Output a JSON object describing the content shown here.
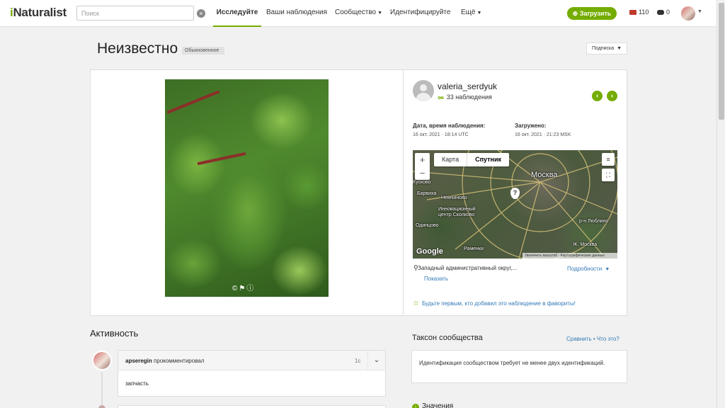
{
  "header": {
    "logo": "iNaturalist",
    "search_placeholder": "Поиск",
    "nav": [
      "Исследуйте",
      "Ваши наблюдения",
      "Сообщество",
      "Идентифицируйте",
      "Ещё"
    ],
    "upload_label": "Загрузить",
    "messages_count": "110",
    "notifications_count": "0"
  },
  "observation": {
    "title": "Неизвестно",
    "badge": "Обыкновенное",
    "subscribe_label": "Подписка"
  },
  "observer": {
    "username": "valeria_serdyuk",
    "observations": "33 наблюдения",
    "date_label": "Дата, время наблюдения:",
    "date_value": "16 окт. 2021 · 18:14 UTC",
    "uploaded_label": "Загружено:",
    "uploaded_value": "16 окт. 2021 · 21:23 MSK"
  },
  "map": {
    "type_map": "Карта",
    "type_satellite": "Спутник",
    "city": "Москва",
    "labels": [
      "Кусково",
      "Барвиха",
      "Немчиново",
      "Инновационный центр Сколково",
      "Одинцово",
      "Раменки",
      "р-н Люблино",
      "Ж. Москва"
    ],
    "google": "Google",
    "footer": "Увеличить масштаб · Картографические данные",
    "place": "Западный административный округ,...",
    "show_label": "Показать",
    "details_label": "Подробности"
  },
  "favorite_text": "Будьте первым, кто добавил это наблюдение в фавориты!",
  "activity": {
    "heading": "Активность",
    "comment_user": "apseregin",
    "comment_action": "прокомментировал",
    "comment_time": "1с",
    "comment_body": "запчасть"
  },
  "community": {
    "heading": "Таксон сообщества",
    "compare_label": "Сравнить",
    "what_label": "Что это?",
    "body": "Идентификация сообществом требует не менее двух идентификаций."
  },
  "values_heading": "Значения",
  "colors": {
    "accent": "#74ac00",
    "link": "#337ab7"
  }
}
